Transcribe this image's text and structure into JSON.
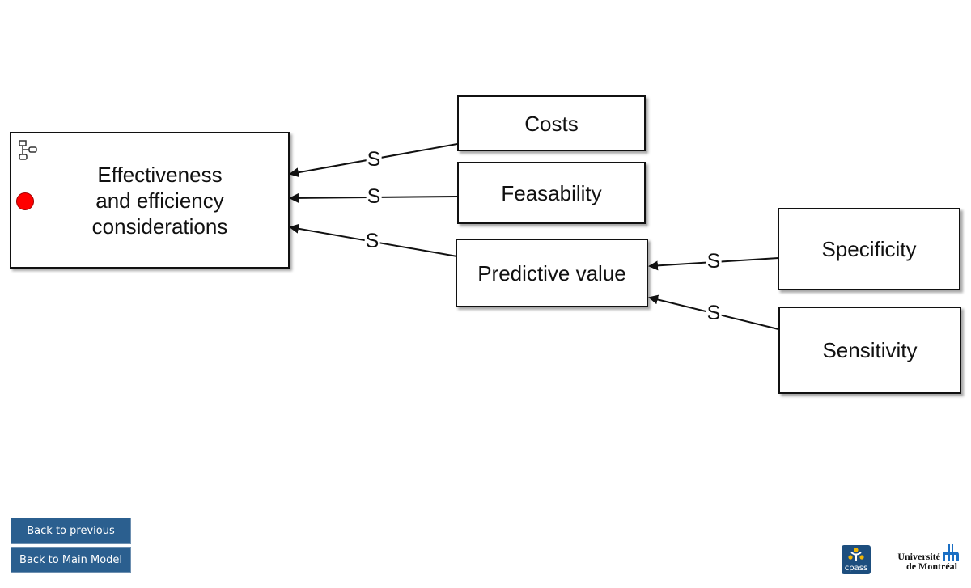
{
  "diagram": {
    "nodes": [
      {
        "id": "effectiveness",
        "label": "Effectiveness\nand efficiency\nconsiderations",
        "has_submodel_icon": true,
        "status_color": "#ff0000"
      },
      {
        "id": "costs",
        "label": "Costs"
      },
      {
        "id": "feasability",
        "label": "Feasability"
      },
      {
        "id": "predictive",
        "label": "Predictive value"
      },
      {
        "id": "specificity",
        "label": "Specificity"
      },
      {
        "id": "sensitivity",
        "label": "Sensitivity"
      }
    ],
    "edges": [
      {
        "from": "costs",
        "to": "effectiveness",
        "label": "S"
      },
      {
        "from": "feasability",
        "to": "effectiveness",
        "label": "S"
      },
      {
        "from": "predictive",
        "to": "effectiveness",
        "label": "S"
      },
      {
        "from": "specificity",
        "to": "predictive",
        "label": "S"
      },
      {
        "from": "sensitivity",
        "to": "predictive",
        "label": "S"
      }
    ]
  },
  "navigation": {
    "back_previous": "Back to previous",
    "back_main": "Back to Main Model"
  },
  "logos": {
    "cpass": "cpass",
    "udem_line1": "Université",
    "udem_line2": "de Montréal"
  },
  "colors": {
    "button_bg": "#2b5f8f",
    "status_red": "#ff0000",
    "cpass_bg": "#1d4e7e",
    "udem_blue": "#1a6fc4"
  }
}
